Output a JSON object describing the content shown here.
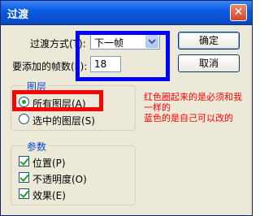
{
  "window": {
    "title": "过渡",
    "close_glyph": "✕"
  },
  "transition_method": {
    "label": "过渡方式(T):",
    "selected": "下一帧"
  },
  "frames": {
    "label": "要添加的帧数(F):",
    "value": "18"
  },
  "buttons": {
    "ok": "确定",
    "cancel": "取消"
  },
  "layers": {
    "group_label": "图层",
    "options": [
      {
        "label": "所有图层(A)",
        "selected": true
      },
      {
        "label": "选中的图层(S)",
        "selected": false
      }
    ]
  },
  "params": {
    "group_label": "参数",
    "options": [
      {
        "label": "位置(P)",
        "checked": true
      },
      {
        "label": "不透明度(O)",
        "checked": true
      },
      {
        "label": "效果(E)",
        "checked": true
      }
    ]
  },
  "annotation": {
    "lines": [
      "红色圈起来的是必须和我",
      "一样的",
      "蓝色的是自己可以改的"
    ],
    "red_color": "#ff0000",
    "blue_color": "#0000ff"
  }
}
